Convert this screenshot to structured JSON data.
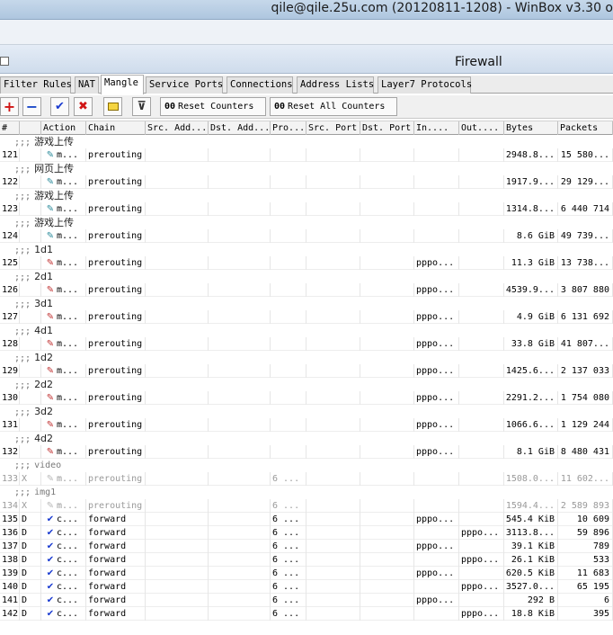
{
  "titlebar": {
    "text": "qile@qile.25u.com (20120811-1208) - WinBox v3.30 o"
  },
  "window": {
    "title": "Firewall"
  },
  "tabs": [
    {
      "label": "Filter Rules",
      "active": false
    },
    {
      "label": "NAT",
      "active": false
    },
    {
      "label": "Mangle",
      "active": true
    },
    {
      "label": "Service Ports",
      "active": false
    },
    {
      "label": "Connections",
      "active": false
    },
    {
      "label": "Address Lists",
      "active": false
    },
    {
      "label": "Layer7 Protocols",
      "active": false
    }
  ],
  "toolbar": {
    "add_icon": "plus-icon",
    "remove_icon": "minus-icon",
    "enable_icon": "check-icon",
    "disable_icon": "x-icon",
    "comment_icon": "comment-icon",
    "filter_icon": "filter-icon",
    "counter_prefix": "00",
    "reset_counters": "Reset Counters",
    "reset_all_counters": "Reset All Counters"
  },
  "columns": {
    "num": "#",
    "flag": "",
    "action": "Action",
    "chain": "Chain",
    "src": "Src. Add...",
    "dst": "Dst. Add...",
    "proto": "Pro...",
    "sport": "Src. Port",
    "dport": "Dst. Port",
    "in": "In....",
    "out": "Out....",
    "bytes": "Bytes",
    "packets": "Packets"
  },
  "rows": [
    {
      "comment": "游戏上传",
      "num": "121",
      "flag": "",
      "icon": "teal",
      "action": "m...",
      "chain": "prerouting",
      "proto": "",
      "in": "",
      "out": "",
      "bytes": "2948.8...",
      "packets": "15 580...",
      "disabled": false
    },
    {
      "comment": "网页上传",
      "num": "122",
      "flag": "",
      "icon": "teal",
      "action": "m...",
      "chain": "prerouting",
      "proto": "",
      "in": "",
      "out": "",
      "bytes": "1917.9...",
      "packets": "29 129...",
      "disabled": false
    },
    {
      "comment": "游戏上传",
      "num": "123",
      "flag": "",
      "icon": "teal",
      "action": "m...",
      "chain": "prerouting",
      "proto": "",
      "in": "",
      "out": "",
      "bytes": "1314.8...",
      "packets": "6 440 714",
      "disabled": false
    },
    {
      "comment": "游戏上传",
      "num": "124",
      "flag": "",
      "icon": "teal",
      "action": "m...",
      "chain": "prerouting",
      "proto": "",
      "in": "",
      "out": "",
      "bytes": "8.6 GiB",
      "packets": "49 739...",
      "disabled": false
    },
    {
      "comment": "1d1",
      "num": "125",
      "flag": "",
      "icon": "red",
      "action": "m...",
      "chain": "prerouting",
      "proto": "",
      "in": "pppo...",
      "out": "",
      "bytes": "11.3 GiB",
      "packets": "13 738...",
      "disabled": false
    },
    {
      "comment": "2d1",
      "num": "126",
      "flag": "",
      "icon": "red",
      "action": "m...",
      "chain": "prerouting",
      "proto": "",
      "in": "pppo...",
      "out": "",
      "bytes": "4539.9...",
      "packets": "3 807 880",
      "disabled": false
    },
    {
      "comment": "3d1",
      "num": "127",
      "flag": "",
      "icon": "red",
      "action": "m...",
      "chain": "prerouting",
      "proto": "",
      "in": "pppo...",
      "out": "",
      "bytes": "4.9 GiB",
      "packets": "6 131 692",
      "disabled": false
    },
    {
      "comment": "4d1",
      "num": "128",
      "flag": "",
      "icon": "red",
      "action": "m...",
      "chain": "prerouting",
      "proto": "",
      "in": "pppo...",
      "out": "",
      "bytes": "33.8 GiB",
      "packets": "41 807...",
      "disabled": false
    },
    {
      "comment": "1d2",
      "num": "129",
      "flag": "",
      "icon": "red",
      "action": "m...",
      "chain": "prerouting",
      "proto": "",
      "in": "pppo...",
      "out": "",
      "bytes": "1425.6...",
      "packets": "2 137 033",
      "disabled": false
    },
    {
      "comment": "2d2",
      "num": "130",
      "flag": "",
      "icon": "red",
      "action": "m...",
      "chain": "prerouting",
      "proto": "",
      "in": "pppo...",
      "out": "",
      "bytes": "2291.2...",
      "packets": "1 754 080",
      "disabled": false
    },
    {
      "comment": "3d2",
      "num": "131",
      "flag": "",
      "icon": "red",
      "action": "m...",
      "chain": "prerouting",
      "proto": "",
      "in": "pppo...",
      "out": "",
      "bytes": "1066.6...",
      "packets": "1 129 244",
      "disabled": false
    },
    {
      "comment": "4d2",
      "num": "132",
      "flag": "",
      "icon": "red",
      "action": "m...",
      "chain": "prerouting",
      "proto": "",
      "in": "pppo...",
      "out": "",
      "bytes": "8.1 GiB",
      "packets": "8 480 431",
      "disabled": false
    },
    {
      "comment": "video",
      "num": "133",
      "flag": "X",
      "icon": "grey",
      "action": "m...",
      "chain": "prerouting",
      "proto": "6 ...",
      "in": "",
      "out": "",
      "bytes": "1508.0...",
      "packets": "11 602...",
      "disabled": true
    },
    {
      "comment": "img1",
      "num": "134",
      "flag": "X",
      "icon": "grey",
      "action": "m...",
      "chain": "prerouting",
      "proto": "6 ...",
      "in": "",
      "out": "",
      "bytes": "1594.4...",
      "packets": "2 589 893",
      "disabled": true
    },
    {
      "num": "135",
      "flag": "D",
      "icon": "check",
      "action": "c...",
      "chain": "forward",
      "proto": "6 ...",
      "in": "pppo...",
      "out": "",
      "bytes": "545.4 KiB",
      "packets": "10 609",
      "disabled": false
    },
    {
      "num": "136",
      "flag": "D",
      "icon": "check",
      "action": "c...",
      "chain": "forward",
      "proto": "6 ...",
      "in": "",
      "out": "pppo...",
      "bytes": "3113.8...",
      "packets": "59 896",
      "disabled": false
    },
    {
      "num": "137",
      "flag": "D",
      "icon": "check",
      "action": "c...",
      "chain": "forward",
      "proto": "6 ...",
      "in": "pppo...",
      "out": "",
      "bytes": "39.1 KiB",
      "packets": "789",
      "disabled": false
    },
    {
      "num": "138",
      "flag": "D",
      "icon": "check",
      "action": "c...",
      "chain": "forward",
      "proto": "6 ...",
      "in": "",
      "out": "pppo...",
      "bytes": "26.1 KiB",
      "packets": "533",
      "disabled": false
    },
    {
      "num": "139",
      "flag": "D",
      "icon": "check",
      "action": "c...",
      "chain": "forward",
      "proto": "6 ...",
      "in": "pppo...",
      "out": "",
      "bytes": "620.5 KiB",
      "packets": "11 683",
      "disabled": false
    },
    {
      "num": "140",
      "flag": "D",
      "icon": "check",
      "action": "c...",
      "chain": "forward",
      "proto": "6 ...",
      "in": "",
      "out": "pppo...",
      "bytes": "3527.0...",
      "packets": "65 195",
      "disabled": false
    },
    {
      "num": "141",
      "flag": "D",
      "icon": "check",
      "action": "c...",
      "chain": "forward",
      "proto": "6 ...",
      "in": "pppo...",
      "out": "",
      "bytes": "292 B",
      "packets": "6",
      "disabled": false
    },
    {
      "num": "142",
      "flag": "D",
      "icon": "check",
      "action": "c...",
      "chain": "forward",
      "proto": "6 ...",
      "in": "",
      "out": "pppo...",
      "bytes": "18.8 KiB",
      "packets": "395",
      "disabled": false
    }
  ],
  "comment_prefix": ";;;"
}
